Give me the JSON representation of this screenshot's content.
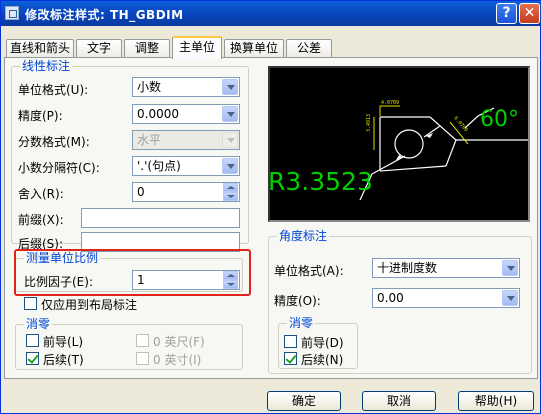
{
  "window": {
    "title": "修改标注样式: TH_GBDIM",
    "help_label": "?",
    "close_label": "✕"
  },
  "tabs": [
    {
      "label": "直线和箭头"
    },
    {
      "label": "文字"
    },
    {
      "label": "调整"
    },
    {
      "label": "主单位",
      "active": true
    },
    {
      "label": "换算单位"
    },
    {
      "label": "公差"
    }
  ],
  "linear": {
    "legend": "线性标注",
    "unit_format_label": "单位格式(U):",
    "unit_format_value": "小数",
    "precision_label": "精度(P):",
    "precision_value": "0.0000",
    "fraction_format_label": "分数格式(M):",
    "fraction_format_value": "水平",
    "decimal_sep_label": "小数分隔符(C):",
    "decimal_sep_value": "'.'(句点)",
    "round_label": "舍入(R):",
    "round_value": "0",
    "prefix_label": "前缀(X):",
    "prefix_value": "",
    "suffix_label": "后缀(S):",
    "suffix_value": ""
  },
  "scale": {
    "legend": "测量单位比例",
    "factor_label": "比例因子(E):",
    "factor_value": "1",
    "layout_only_label": "仅应用到布局标注",
    "layout_only_checked": false
  },
  "zero_linear": {
    "legend": "消零",
    "leading_label": "前导(L)",
    "leading_checked": false,
    "trailing_label": "后续(T)",
    "trailing_checked": true,
    "feet_label": "0 英尺(F)",
    "feet_checked": false,
    "inches_label": "0 英寸(I)",
    "inches_checked": false
  },
  "preview": {
    "big_label": "R3.3523",
    "angle_label": "60°",
    "dim1": "4.0709",
    "dim2": "3.4913",
    "dim3": "6.0709",
    "colors": {
      "text": "#00d000",
      "dims": "#e0e000",
      "lines": "#ffffff"
    }
  },
  "angular": {
    "legend": "角度标注",
    "unit_format_label": "单位格式(A):",
    "unit_format_value": "十进制度数",
    "precision_label": "精度(O):",
    "precision_value": "0.00"
  },
  "zero_angular": {
    "legend": "消零",
    "leading_label": "前导(D)",
    "leading_checked": false,
    "trailing_label": "后续(N)",
    "trailing_checked": true
  },
  "buttons": {
    "ok": "确定",
    "cancel": "取消",
    "help": "帮助(H)"
  },
  "colors": {
    "accent": "#0046d5",
    "highlight": "#e0241c",
    "title_bar": "#0a5fd8"
  }
}
